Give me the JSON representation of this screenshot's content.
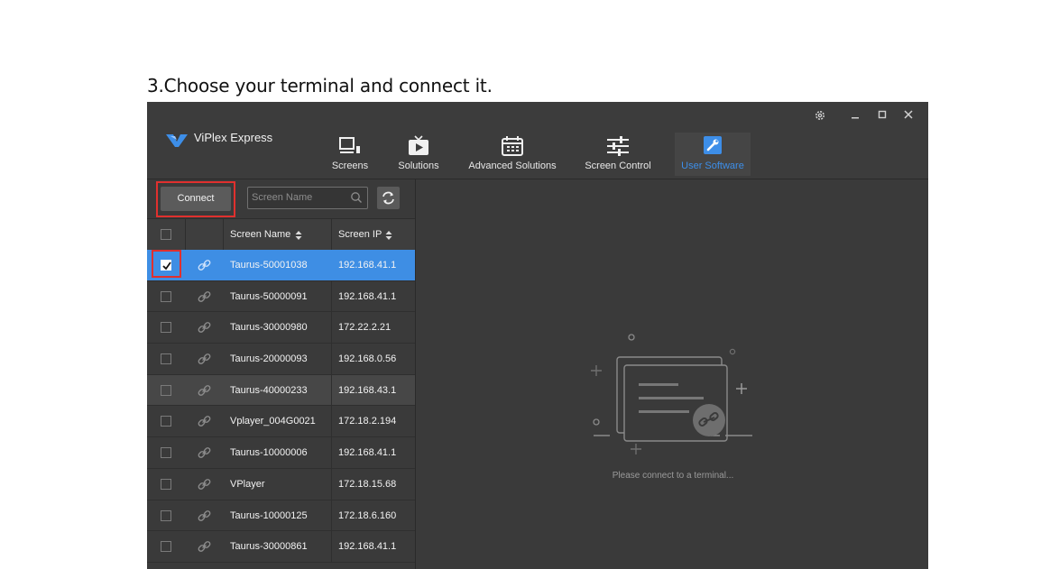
{
  "doc": {
    "heading": "3.Choose your terminal and connect it."
  },
  "app": {
    "title": "ViPlex Express"
  },
  "nav": [
    {
      "label": "Screens",
      "icon": "monitor-icon",
      "active": false
    },
    {
      "label": "Solutions",
      "icon": "play-tv-icon",
      "active": false
    },
    {
      "label": "Advanced Solutions",
      "icon": "calendar-icon",
      "active": false
    },
    {
      "label": "Screen Control",
      "icon": "sliders-icon",
      "active": false
    },
    {
      "label": "User Software",
      "icon": "wrench-icon",
      "active": true
    }
  ],
  "window_controls": {
    "settings": "gear-icon",
    "minimize": "minimize-icon",
    "maximize": "maximize-icon",
    "close": "close-icon"
  },
  "toolbar": {
    "connect_label": "Connect",
    "search_placeholder": "Screen Name"
  },
  "table": {
    "columns": [
      "Screen Name",
      "Screen IP"
    ],
    "rows": [
      {
        "name": "Taurus-50001038",
        "ip": "192.168.41.1",
        "checked": true,
        "state": "selected"
      },
      {
        "name": "Taurus-50000091",
        "ip": "192.168.41.1",
        "checked": false,
        "state": ""
      },
      {
        "name": "Taurus-30000980",
        "ip": "172.22.2.21",
        "checked": false,
        "state": ""
      },
      {
        "name": "Taurus-20000093",
        "ip": "192.168.0.56",
        "checked": false,
        "state": ""
      },
      {
        "name": "Taurus-40000233",
        "ip": "192.168.43.1",
        "checked": false,
        "state": "hover"
      },
      {
        "name": "Vplayer_004G0021",
        "ip": "172.18.2.194",
        "checked": false,
        "state": ""
      },
      {
        "name": "Taurus-10000006",
        "ip": "192.168.41.1",
        "checked": false,
        "state": ""
      },
      {
        "name": "VPlayer",
        "ip": "172.18.15.68",
        "checked": false,
        "state": ""
      },
      {
        "name": "Taurus-10000125",
        "ip": "172.18.6.160",
        "checked": false,
        "state": ""
      },
      {
        "name": "Taurus-30000861",
        "ip": "192.168.41.1",
        "checked": false,
        "state": ""
      }
    ]
  },
  "empty_state": {
    "message": "Please connect to a terminal..."
  },
  "colors": {
    "accent": "#3e8ee4",
    "highlight": "#e0302e",
    "background": "#383838"
  }
}
